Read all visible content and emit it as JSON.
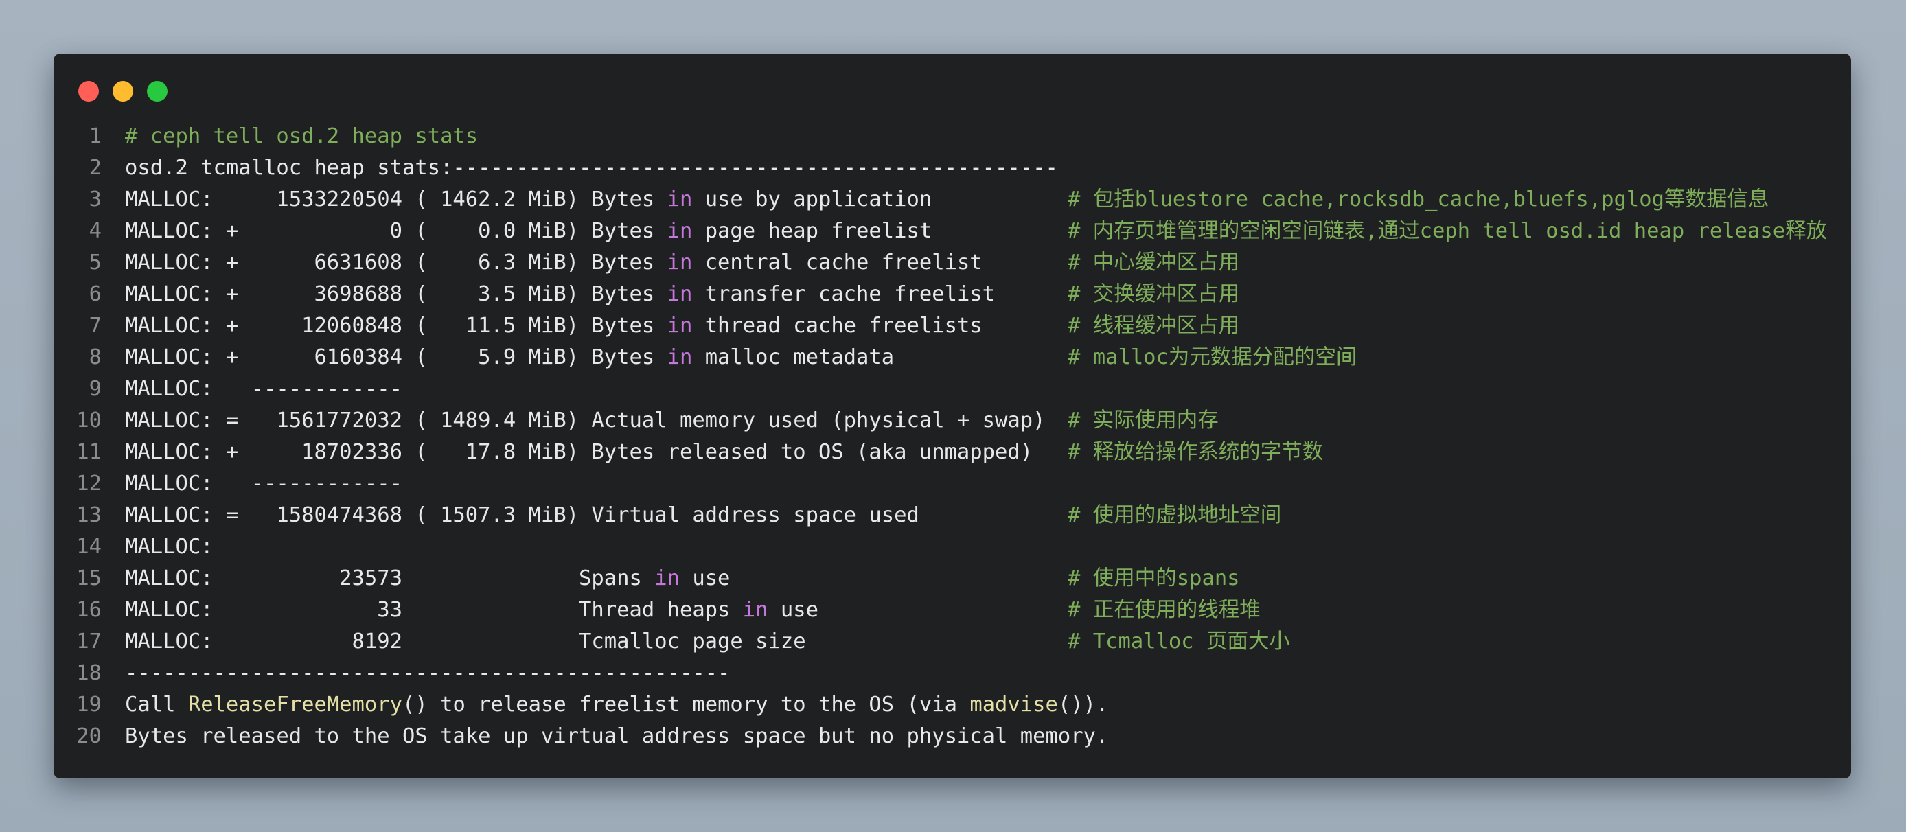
{
  "window": {
    "controls": [
      "close",
      "minimize",
      "maximize"
    ]
  },
  "lines": [
    {
      "n": "1",
      "parts": [
        {
          "t": "# ceph tell osd.2 heap stats",
          "c": "green"
        }
      ],
      "comment": ""
    },
    {
      "n": "2",
      "parts": [
        {
          "t": "osd.2 tcmalloc heap stats:------------------------------------------------",
          "c": ""
        }
      ],
      "comment": ""
    },
    {
      "n": "3",
      "parts": [
        {
          "t": "MALLOC:     1533220504 ( 1462.2 MiB) Bytes ",
          "c": ""
        },
        {
          "t": "in",
          "c": "kw"
        },
        {
          "t": " use by application",
          "c": ""
        }
      ],
      "comment": "# 包括bluestore cache,rocksdb_cache,bluefs,pglog等数据信息"
    },
    {
      "n": "4",
      "parts": [
        {
          "t": "MALLOC: +            0 (    0.0 MiB) Bytes ",
          "c": ""
        },
        {
          "t": "in",
          "c": "kw"
        },
        {
          "t": " page heap freelist",
          "c": ""
        }
      ],
      "comment": "# 内存页堆管理的空闲空间链表,通过ceph tell osd.id heap release释放"
    },
    {
      "n": "5",
      "parts": [
        {
          "t": "MALLOC: +      6631608 (    6.3 MiB) Bytes ",
          "c": ""
        },
        {
          "t": "in",
          "c": "kw"
        },
        {
          "t": " central cache freelist",
          "c": ""
        }
      ],
      "comment": "# 中心缓冲区占用"
    },
    {
      "n": "6",
      "parts": [
        {
          "t": "MALLOC: +      3698688 (    3.5 MiB) Bytes ",
          "c": ""
        },
        {
          "t": "in",
          "c": "kw"
        },
        {
          "t": " transfer cache freelist",
          "c": ""
        }
      ],
      "comment": "# 交换缓冲区占用"
    },
    {
      "n": "7",
      "parts": [
        {
          "t": "MALLOC: +     12060848 (   11.5 MiB) Bytes ",
          "c": ""
        },
        {
          "t": "in",
          "c": "kw"
        },
        {
          "t": " thread cache freelists",
          "c": ""
        }
      ],
      "comment": "# 线程缓冲区占用"
    },
    {
      "n": "8",
      "parts": [
        {
          "t": "MALLOC: +      6160384 (    5.9 MiB) Bytes ",
          "c": ""
        },
        {
          "t": "in",
          "c": "kw"
        },
        {
          "t": " malloc metadata",
          "c": ""
        }
      ],
      "comment": "# malloc为元数据分配的空间"
    },
    {
      "n": "9",
      "parts": [
        {
          "t": "MALLOC:   ------------",
          "c": ""
        }
      ],
      "comment": ""
    },
    {
      "n": "10",
      "parts": [
        {
          "t": "MALLOC: =   1561772032 ( 1489.4 MiB) Actual memory used (physical + swap)",
          "c": ""
        }
      ],
      "comment": "# 实际使用内存"
    },
    {
      "n": "11",
      "parts": [
        {
          "t": "MALLOC: +     18702336 (   17.8 MiB) Bytes released to OS (aka unmapped)",
          "c": ""
        }
      ],
      "comment": "# 释放给操作系统的字节数"
    },
    {
      "n": "12",
      "parts": [
        {
          "t": "MALLOC:   ------------",
          "c": ""
        }
      ],
      "comment": ""
    },
    {
      "n": "13",
      "parts": [
        {
          "t": "MALLOC: =   1580474368 ( 1507.3 MiB) Virtual address space used",
          "c": ""
        }
      ],
      "comment": "# 使用的虚拟地址空间"
    },
    {
      "n": "14",
      "parts": [
        {
          "t": "MALLOC:",
          "c": ""
        }
      ],
      "comment": ""
    },
    {
      "n": "15",
      "parts": [
        {
          "t": "MALLOC:          23573              Spans ",
          "c": ""
        },
        {
          "t": "in",
          "c": "kw"
        },
        {
          "t": " use",
          "c": ""
        }
      ],
      "comment": "# 使用中的spans"
    },
    {
      "n": "16",
      "parts": [
        {
          "t": "MALLOC:             33              Thread heaps ",
          "c": ""
        },
        {
          "t": "in",
          "c": "kw"
        },
        {
          "t": " use",
          "c": ""
        }
      ],
      "comment": "# 正在使用的线程堆"
    },
    {
      "n": "17",
      "parts": [
        {
          "t": "MALLOC:           8192              Tcmalloc page size",
          "c": ""
        }
      ],
      "comment": "# Tcmalloc 页面大小"
    },
    {
      "n": "18",
      "parts": [
        {
          "t": "------------------------------------------------",
          "c": ""
        }
      ],
      "comment": ""
    },
    {
      "n": "19",
      "parts": [
        {
          "t": "Call ",
          "c": ""
        },
        {
          "t": "ReleaseFreeMemory",
          "c": "fn"
        },
        {
          "t": "() to release freelist memory to the OS (via ",
          "c": ""
        },
        {
          "t": "madvise",
          "c": "fn"
        },
        {
          "t": "()).",
          "c": ""
        }
      ],
      "comment": ""
    },
    {
      "n": "20",
      "parts": [
        {
          "t": "Bytes released to the OS take up virtual address space but no physical memory.",
          "c": ""
        }
      ],
      "comment": ""
    }
  ]
}
